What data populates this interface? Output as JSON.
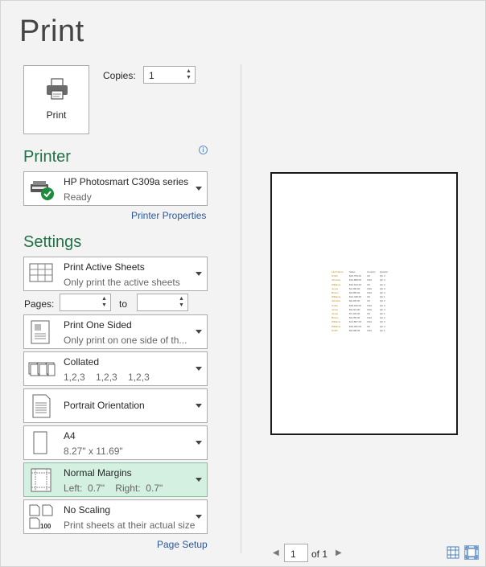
{
  "title": "Print",
  "print_button": {
    "label": "Print",
    "icon": "printer-icon"
  },
  "copies": {
    "label": "Copies:",
    "value": "1"
  },
  "printer": {
    "heading": "Printer",
    "name": "HP Photosmart C309a series",
    "status": "Ready",
    "properties_link": "Printer Properties",
    "info_icon": "i"
  },
  "settings": {
    "heading": "Settings",
    "what": {
      "title": "Print Active Sheets",
      "sub": "Only print the active sheets"
    },
    "pages": {
      "label": "Pages:",
      "to_label": "to",
      "from": "",
      "to": ""
    },
    "sides": {
      "title": "Print One Sided",
      "sub": "Only print on one side of th..."
    },
    "collate": {
      "title": "Collated",
      "sub": "1,2,3    1,2,3    1,2,3"
    },
    "orientation": {
      "title": "Portrait Orientation"
    },
    "paper": {
      "title": "A4",
      "sub": "8.27\" x 11.69\""
    },
    "margins": {
      "title": "Normal Margins",
      "sub": "Left:  0.7\"    Right:  0.7\""
    },
    "scaling": {
      "title": "No Scaling",
      "sub": "Print sheets at their actual size",
      "icon_text": "100"
    },
    "page_setup_link": "Page Setup"
  },
  "preview": {
    "page_number": "1",
    "of_label": "of 1",
    "table": {
      "headers": [
        "Last Name",
        "Sales",
        "Country",
        "Quarter"
      ],
      "rows": [
        [
          "Smith",
          "$16,753.00",
          "UK",
          "Qtr 3"
        ],
        [
          "Johnson",
          "$14,808.00",
          "USA",
          "Qtr 4"
        ],
        [
          "Williams",
          "$10,644.00",
          "UK",
          "Qtr 2"
        ],
        [
          "Jones",
          "$1,390.00",
          "USA",
          "Qtr 3"
        ],
        [
          "Brown",
          "$4,865.00",
          "USA",
          "Qtr 4"
        ],
        [
          "Williams",
          "$12,438.00",
          "UK",
          "Qtr 1"
        ],
        [
          "Johnson",
          "$9,339.00",
          "UK",
          "Qtr 2"
        ],
        [
          "Smith",
          "$18,919.00",
          "USA",
          "Qtr 3"
        ],
        [
          "Jones",
          "$9,213.00",
          "USA",
          "Qtr 4"
        ],
        [
          "Jones",
          "$7,433.00",
          "UK",
          "Qtr 1"
        ],
        [
          "Brown",
          "$3,255.00",
          "USA",
          "Qtr 2"
        ],
        [
          "Williams",
          "$14,867.00",
          "USA",
          "Qtr 3"
        ],
        [
          "Williams",
          "$19,302.00",
          "UK",
          "Qtr 4"
        ],
        [
          "Smith",
          "$9,698.00",
          "USA",
          "Qtr 1"
        ]
      ]
    }
  },
  "colors": {
    "accent": "#217346",
    "link": "#2b579a",
    "selected_bg": "#d3f0e0"
  }
}
